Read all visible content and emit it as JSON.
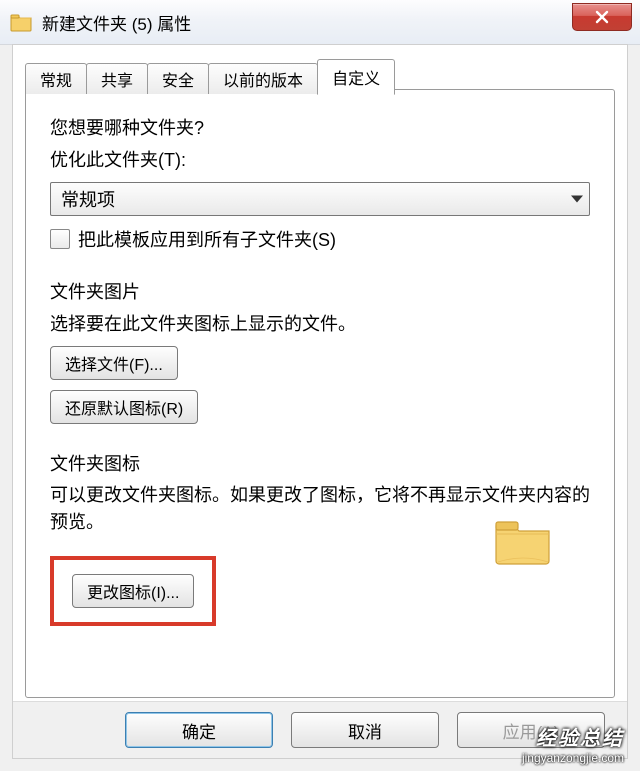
{
  "window": {
    "title": "新建文件夹 (5) 属性"
  },
  "tabs": {
    "t0": "常规",
    "t1": "共享",
    "t2": "安全",
    "t3": "以前的版本",
    "t4": "自定义"
  },
  "section1": {
    "question": "您想要哪种文件夹?",
    "optimize_label": "优化此文件夹(T):",
    "select_value": "常规项",
    "apply_template_label": "把此模板应用到所有子文件夹(S)"
  },
  "section2": {
    "title": "文件夹图片",
    "desc": "选择要在此文件夹图标上显示的文件。",
    "choose_file_btn": "选择文件(F)...",
    "restore_default_btn": "还原默认图标(R)"
  },
  "section3": {
    "title": "文件夹图标",
    "desc": "可以更改文件夹图标。如果更改了图标，它将不再显示文件夹内容的预览。",
    "change_icon_btn": "更改图标(I)..."
  },
  "buttons": {
    "ok": "确定",
    "cancel": "取消",
    "apply": "应用(A)"
  },
  "watermark": {
    "line1": "经验总结",
    "line2": "jingyanzongjie.com"
  }
}
